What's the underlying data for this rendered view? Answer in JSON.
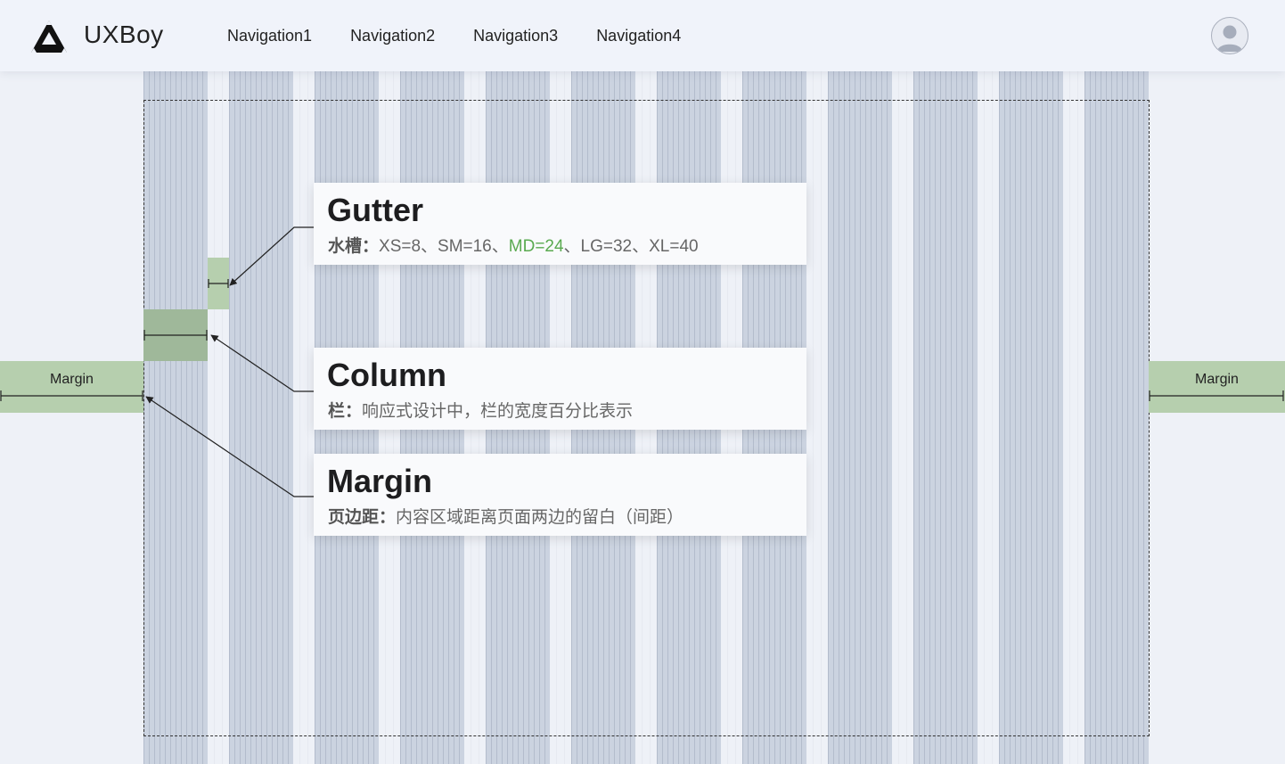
{
  "header": {
    "brand": "UXBoy",
    "nav": [
      "Navigation1",
      "Navigation2",
      "Navigation3",
      "Navigation4"
    ]
  },
  "annotations": {
    "gutter": {
      "title": "Gutter",
      "desc_label": "水槽：",
      "desc_pre": "XS=8、SM=16、",
      "desc_highlight": "MD=24",
      "desc_post": "、LG=32、XL=40"
    },
    "column": {
      "title": "Column",
      "desc_label": "栏：",
      "desc": "响应式设计中，栏的宽度百分比表示"
    },
    "margin": {
      "title": "Margin",
      "desc_label": "页边距：",
      "desc": "内容区域距离页面两边的留白（间距）"
    }
  },
  "margin_left_label": "Margin",
  "margin_right_label": "Margin",
  "colors": {
    "column": "#cbd3e0",
    "highlight": "#b6cfae",
    "accent_green": "#5aaa50",
    "header_bg": "#f0f3fa"
  }
}
